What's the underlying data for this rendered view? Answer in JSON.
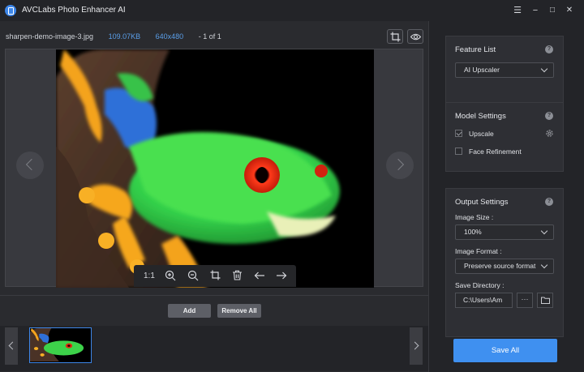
{
  "app": {
    "title": "AVCLabs Photo Enhancer AI"
  },
  "window_controls": {
    "menu": "☰",
    "minimize": "−",
    "maximize": "□",
    "close": "✕"
  },
  "file_info": {
    "name": "sharpen-demo-image-3.jpg",
    "size": "109.07KB",
    "resolution": "640x480",
    "position": "- 1 of 1"
  },
  "zoom_toolbar": {
    "ratio": "1:1"
  },
  "actions": {
    "add": "Add",
    "remove_all": "Remove All"
  },
  "feature_list": {
    "title": "Feature List",
    "help": "?",
    "selected": "AI Upscaler"
  },
  "model_settings": {
    "title": "Model Settings",
    "help": "?",
    "upscale": "Upscale",
    "face_refinement": "Face Refinement"
  },
  "output_settings": {
    "title": "Output Settings",
    "help": "?",
    "image_size_label": "Image Size :",
    "image_size_value": "100%",
    "image_format_label": "Image Format :",
    "image_format_value": "Preserve source format",
    "save_directory_label": "Save Directory :",
    "save_directory_value": "C:\\Users\\Am",
    "more": "···"
  },
  "save_all": "Save All",
  "colors": {
    "accent": "#3f90f0",
    "panel": "#2e2f34",
    "background": "#232428"
  },
  "icons": [
    "app-logo-icon",
    "crop-icon",
    "eye-icon",
    "zoom-in-icon",
    "zoom-out-icon",
    "trash-icon",
    "arrow-left-icon",
    "arrow-right-icon",
    "gear-icon",
    "folder-icon",
    "help-icon",
    "chevron-down-icon"
  ]
}
